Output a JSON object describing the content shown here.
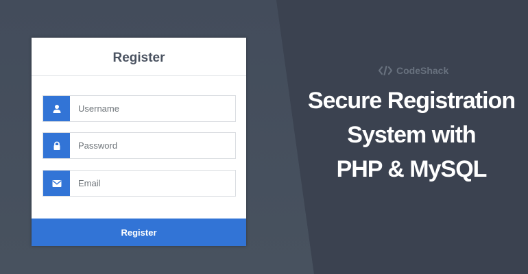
{
  "form": {
    "title": "Register",
    "fields": [
      {
        "icon": "user-icon",
        "placeholder": "Username"
      },
      {
        "icon": "lock-icon",
        "placeholder": "Password"
      },
      {
        "icon": "envelope-icon",
        "placeholder": "Email"
      }
    ],
    "submit_label": "Register"
  },
  "brand": {
    "name": "CodeShack",
    "icon": "code-icon"
  },
  "headline": {
    "lines": [
      "Secure Registration",
      "System with",
      "PHP & MySQL"
    ]
  },
  "colors": {
    "accent": "#3274d6",
    "background": "#3b4250",
    "card": "#ffffff"
  }
}
